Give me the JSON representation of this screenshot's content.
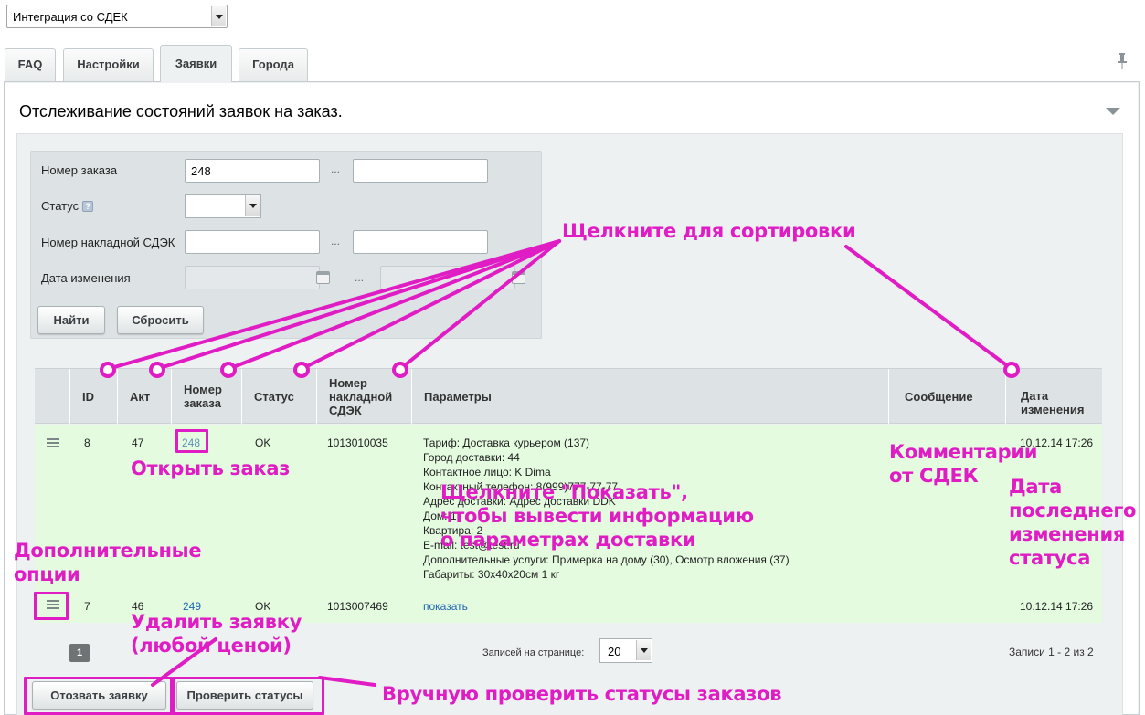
{
  "module_select": {
    "value": "Интеграция со СДЕК"
  },
  "tabs": [
    {
      "label": "FAQ"
    },
    {
      "label": "Настройки"
    },
    {
      "label": "Заявки"
    },
    {
      "label": "Города"
    }
  ],
  "panel": {
    "title": "Отслеживание состояний заявок на заказ."
  },
  "filter": {
    "order_number_label": "Номер заказа",
    "order_number_from": "248",
    "order_number_to": "",
    "status_label": "Статус",
    "status_value": "",
    "waybill_label": "Номер накладной СДЭК",
    "date_label": "Дата изменения",
    "separator": "...",
    "find_button": "Найти",
    "reset_button": "Сбросить"
  },
  "table": {
    "headers": {
      "id": "ID",
      "act": "Акт",
      "order_number": "Номер заказа",
      "status": "Статус",
      "waybill": "Номер накладной СДЭК",
      "params": "Параметры",
      "message": "Сообщение",
      "date": "Дата изменения"
    },
    "rows": [
      {
        "id": "8",
        "act": "47",
        "order": "248",
        "status": "OK",
        "waybill": "1013010035",
        "params": [
          "Тариф: Доставка курьером (137)",
          "Город доставки: 44",
          "Контактное лицо: K Dima",
          "Контактный телефон: 8(999)777-77-77",
          "Адрес доставки: Адрес доставки DDK",
          "Дом: 1",
          "Квартира: 2",
          "E-mail: test@test.ru",
          "Дополнительные услуги: Примерка на дому (30), Осмотр вложения (37)",
          "Габариты: 30x40x20см 1 кг"
        ],
        "message": "",
        "date": "10.12.14 17:26"
      },
      {
        "id": "7",
        "act": "46",
        "order": "249",
        "status": "OK",
        "waybill": "1013007469",
        "params_link": "показать",
        "message": "",
        "date": "10.12.14 17:26"
      }
    ]
  },
  "pager": {
    "current_page": "1",
    "per_page_label": "Записей на странице:",
    "per_page_value": "20",
    "records_info": "Записи 1 - 2 из 2"
  },
  "actions": {
    "revoke_button": "Отозвать заявку",
    "check_button": "Проверить статусы"
  },
  "annotations": {
    "click_to_sort": "Щелкните для сортировки",
    "open_order": "Открыть заказ",
    "show_params_1": "Щелкните \"Показать\",",
    "show_params_2": "чтобы вывести информацию",
    "show_params_3": "о параметрах доставки",
    "comments_1": "Комментарии",
    "comments_2": "от СДЕК",
    "date_1": "Дата",
    "date_2": "последнего",
    "date_3": "изменения",
    "date_4": "статуса",
    "more_options_1": "Дополнительные",
    "more_options_2": "опции",
    "delete_1": "Удалить заявку",
    "delete_2": "(любой ценой)",
    "manual_check": "Вручную проверить статусы заказов"
  },
  "colors": {
    "annotation": "#e01cc4",
    "row_bg": "#e4fbe0",
    "link": "#2067b0"
  }
}
